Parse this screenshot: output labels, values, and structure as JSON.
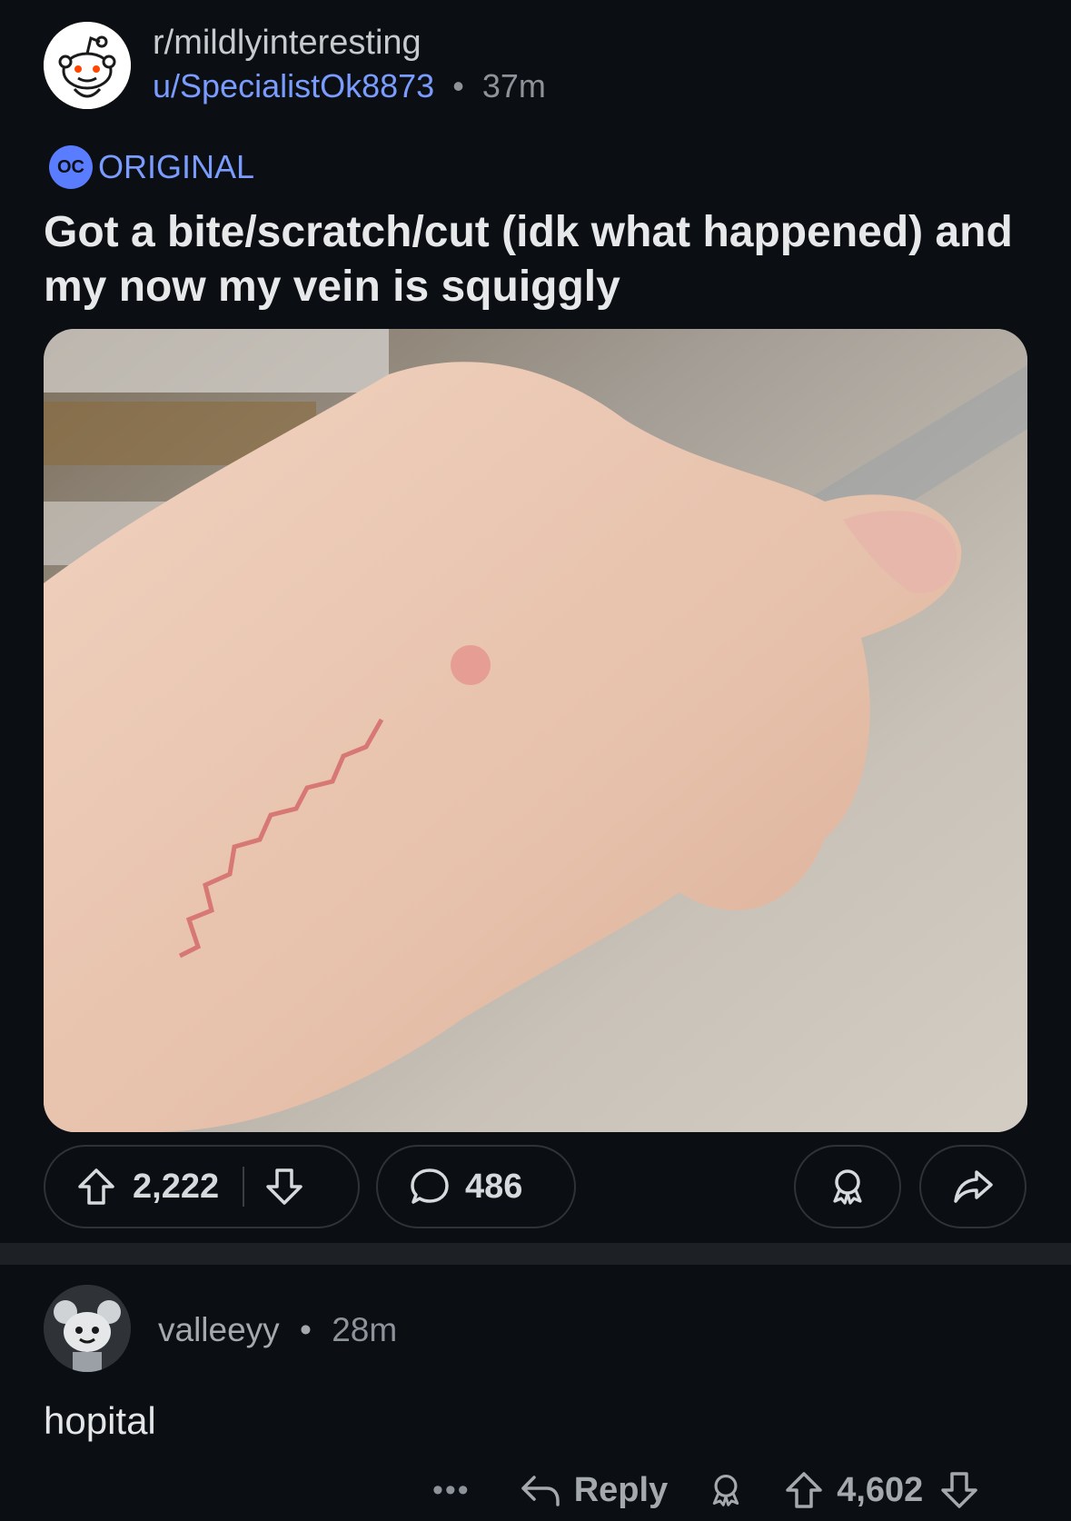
{
  "post": {
    "subreddit": "r/mildlyinteresting",
    "username": "u/SpecialistOk8873",
    "separator": "•",
    "time_ago": "37m",
    "flair_icon": "OC",
    "flair": "ORIGINAL",
    "title": "Got a bite/scratch/cut (idk what happened) and my now my vein is squiggly",
    "upvotes": "2,222",
    "comments": "486"
  },
  "comment": {
    "username": "valleeyy",
    "separator": "•",
    "time_ago": "28m",
    "text": "hopital",
    "more": "•••",
    "reply_label": "Reply",
    "score": "4,602"
  },
  "colors": {
    "background": "#0b0e12",
    "accent_blue": "#7a9cff",
    "oc_badge": "#5a7cff",
    "border": "#2e3338"
  },
  "icons": [
    "snoo-avatar-icon",
    "upvote-icon",
    "downvote-icon",
    "comment-icon",
    "award-icon",
    "share-icon",
    "reply-icon",
    "more-icon"
  ]
}
